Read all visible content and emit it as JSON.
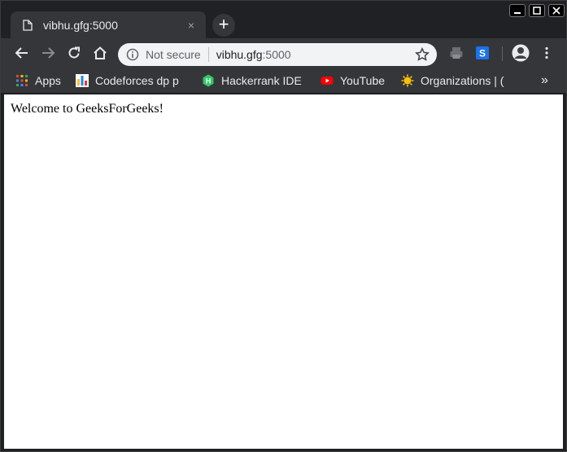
{
  "tab": {
    "title": "vibhu.gfg:5000",
    "close": "×"
  },
  "newtab": {
    "label": "+"
  },
  "omnibox": {
    "security_label": "Not secure",
    "host": "vibhu.gfg",
    "port": ":5000"
  },
  "bookmarks": [
    {
      "label": "Apps",
      "icon": "apps-grid-icon"
    },
    {
      "label": "Codeforces dp p",
      "icon": "codeforces-icon"
    },
    {
      "label": "Hackerrank IDE",
      "icon": "hackerrank-icon"
    },
    {
      "label": "YouTube",
      "icon": "youtube-icon"
    },
    {
      "label": "Organizations | (",
      "icon": "organizations-icon"
    }
  ],
  "bookmarks_overflow": "»",
  "page": {
    "text": "Welcome to GeeksForGeeks!"
  },
  "colors": {
    "chrome_dark": "#202124",
    "toolbar": "#35363a",
    "omnibox": "#f1f3f4",
    "page_bg": "#ffffff"
  }
}
